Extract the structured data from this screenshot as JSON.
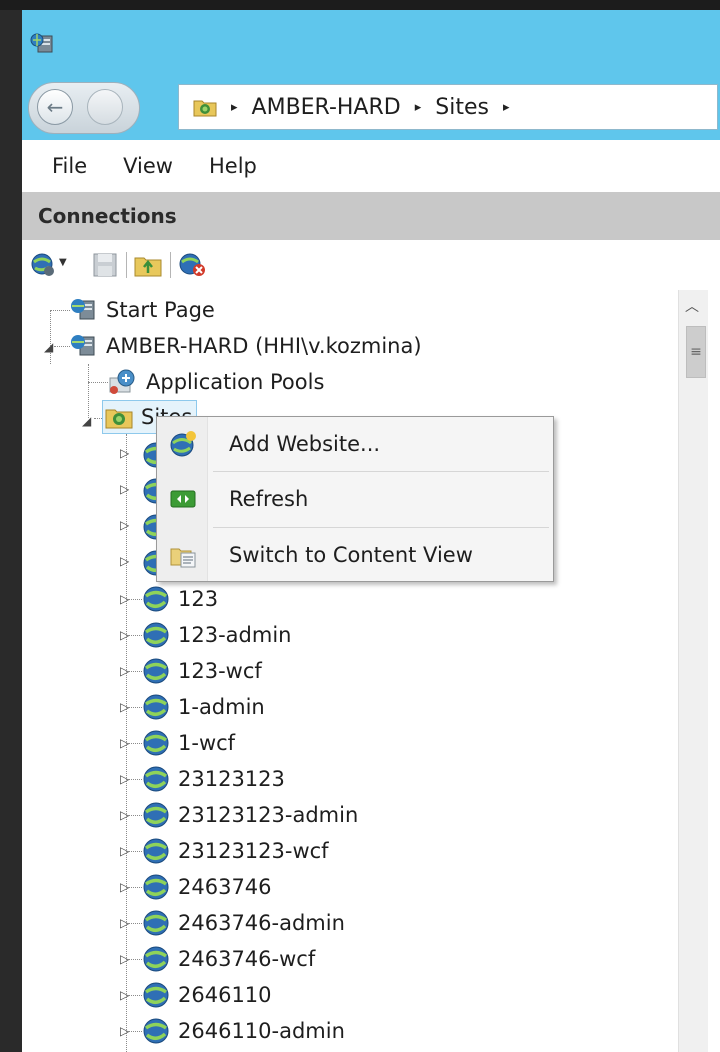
{
  "window": {
    "icon": "iis-manager-icon"
  },
  "navigation": {
    "back_icon": "back-arrow-icon",
    "forward_icon": "forward-arrow-icon",
    "breadcrumb": [
      "AMBER-HARD",
      "Sites"
    ],
    "breadcrumb_separator": "▸"
  },
  "menu": {
    "items": [
      "File",
      "View",
      "Help"
    ]
  },
  "connections": {
    "title": "Connections",
    "toolbar_icons": [
      "connect-icon",
      "dropdown-arrow-icon",
      "save-icon",
      "folder-up-icon",
      "disconnect-icon"
    ]
  },
  "tree": {
    "start_page": "Start Page",
    "server": "AMBER-HARD (HHI\\v.kozmina)",
    "app_pools": "Application Pools",
    "sites": "Sites",
    "site_items": [
      "123",
      "123-admin",
      "123-wcf",
      "1-admin",
      "1-wcf",
      "23123123",
      "23123123-admin",
      "23123123-wcf",
      "2463746",
      "2463746-admin",
      "2463746-wcf",
      "2646110",
      "2646110-admin"
    ]
  },
  "context_menu": {
    "items": [
      {
        "label": "Add Website...",
        "icon": "add-website-icon"
      },
      {
        "label": "Refresh",
        "icon": "refresh-icon"
      },
      {
        "label": "Switch to Content View",
        "icon": "content-view-icon"
      }
    ]
  },
  "colors": {
    "title_bar": "#5fc6ec",
    "header_gray": "#c8c8c8",
    "selection": "#e5f3fb"
  }
}
